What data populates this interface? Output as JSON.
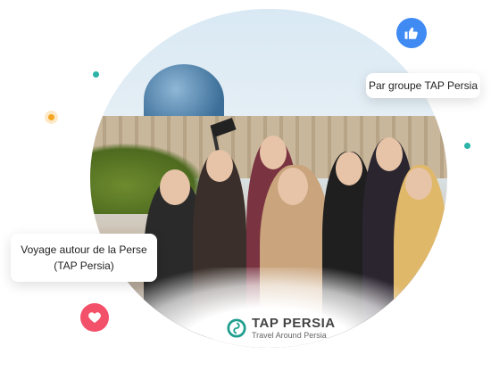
{
  "cards": {
    "top": "Par groupe TAP Persia",
    "left_line1": "Voyage autour de la Perse",
    "left_line2": "(TAP Persia)"
  },
  "logo": {
    "name": "TAP PERSIA",
    "tagline": "Travel Around Persia"
  },
  "icons": {
    "like": "thumbs-up-icon",
    "heart": "heart-icon"
  },
  "colors": {
    "like_bg": "#3f8af3",
    "heart_bg": "#f3506a",
    "teal": "#2bb3a6",
    "orange": "#f5a623"
  }
}
